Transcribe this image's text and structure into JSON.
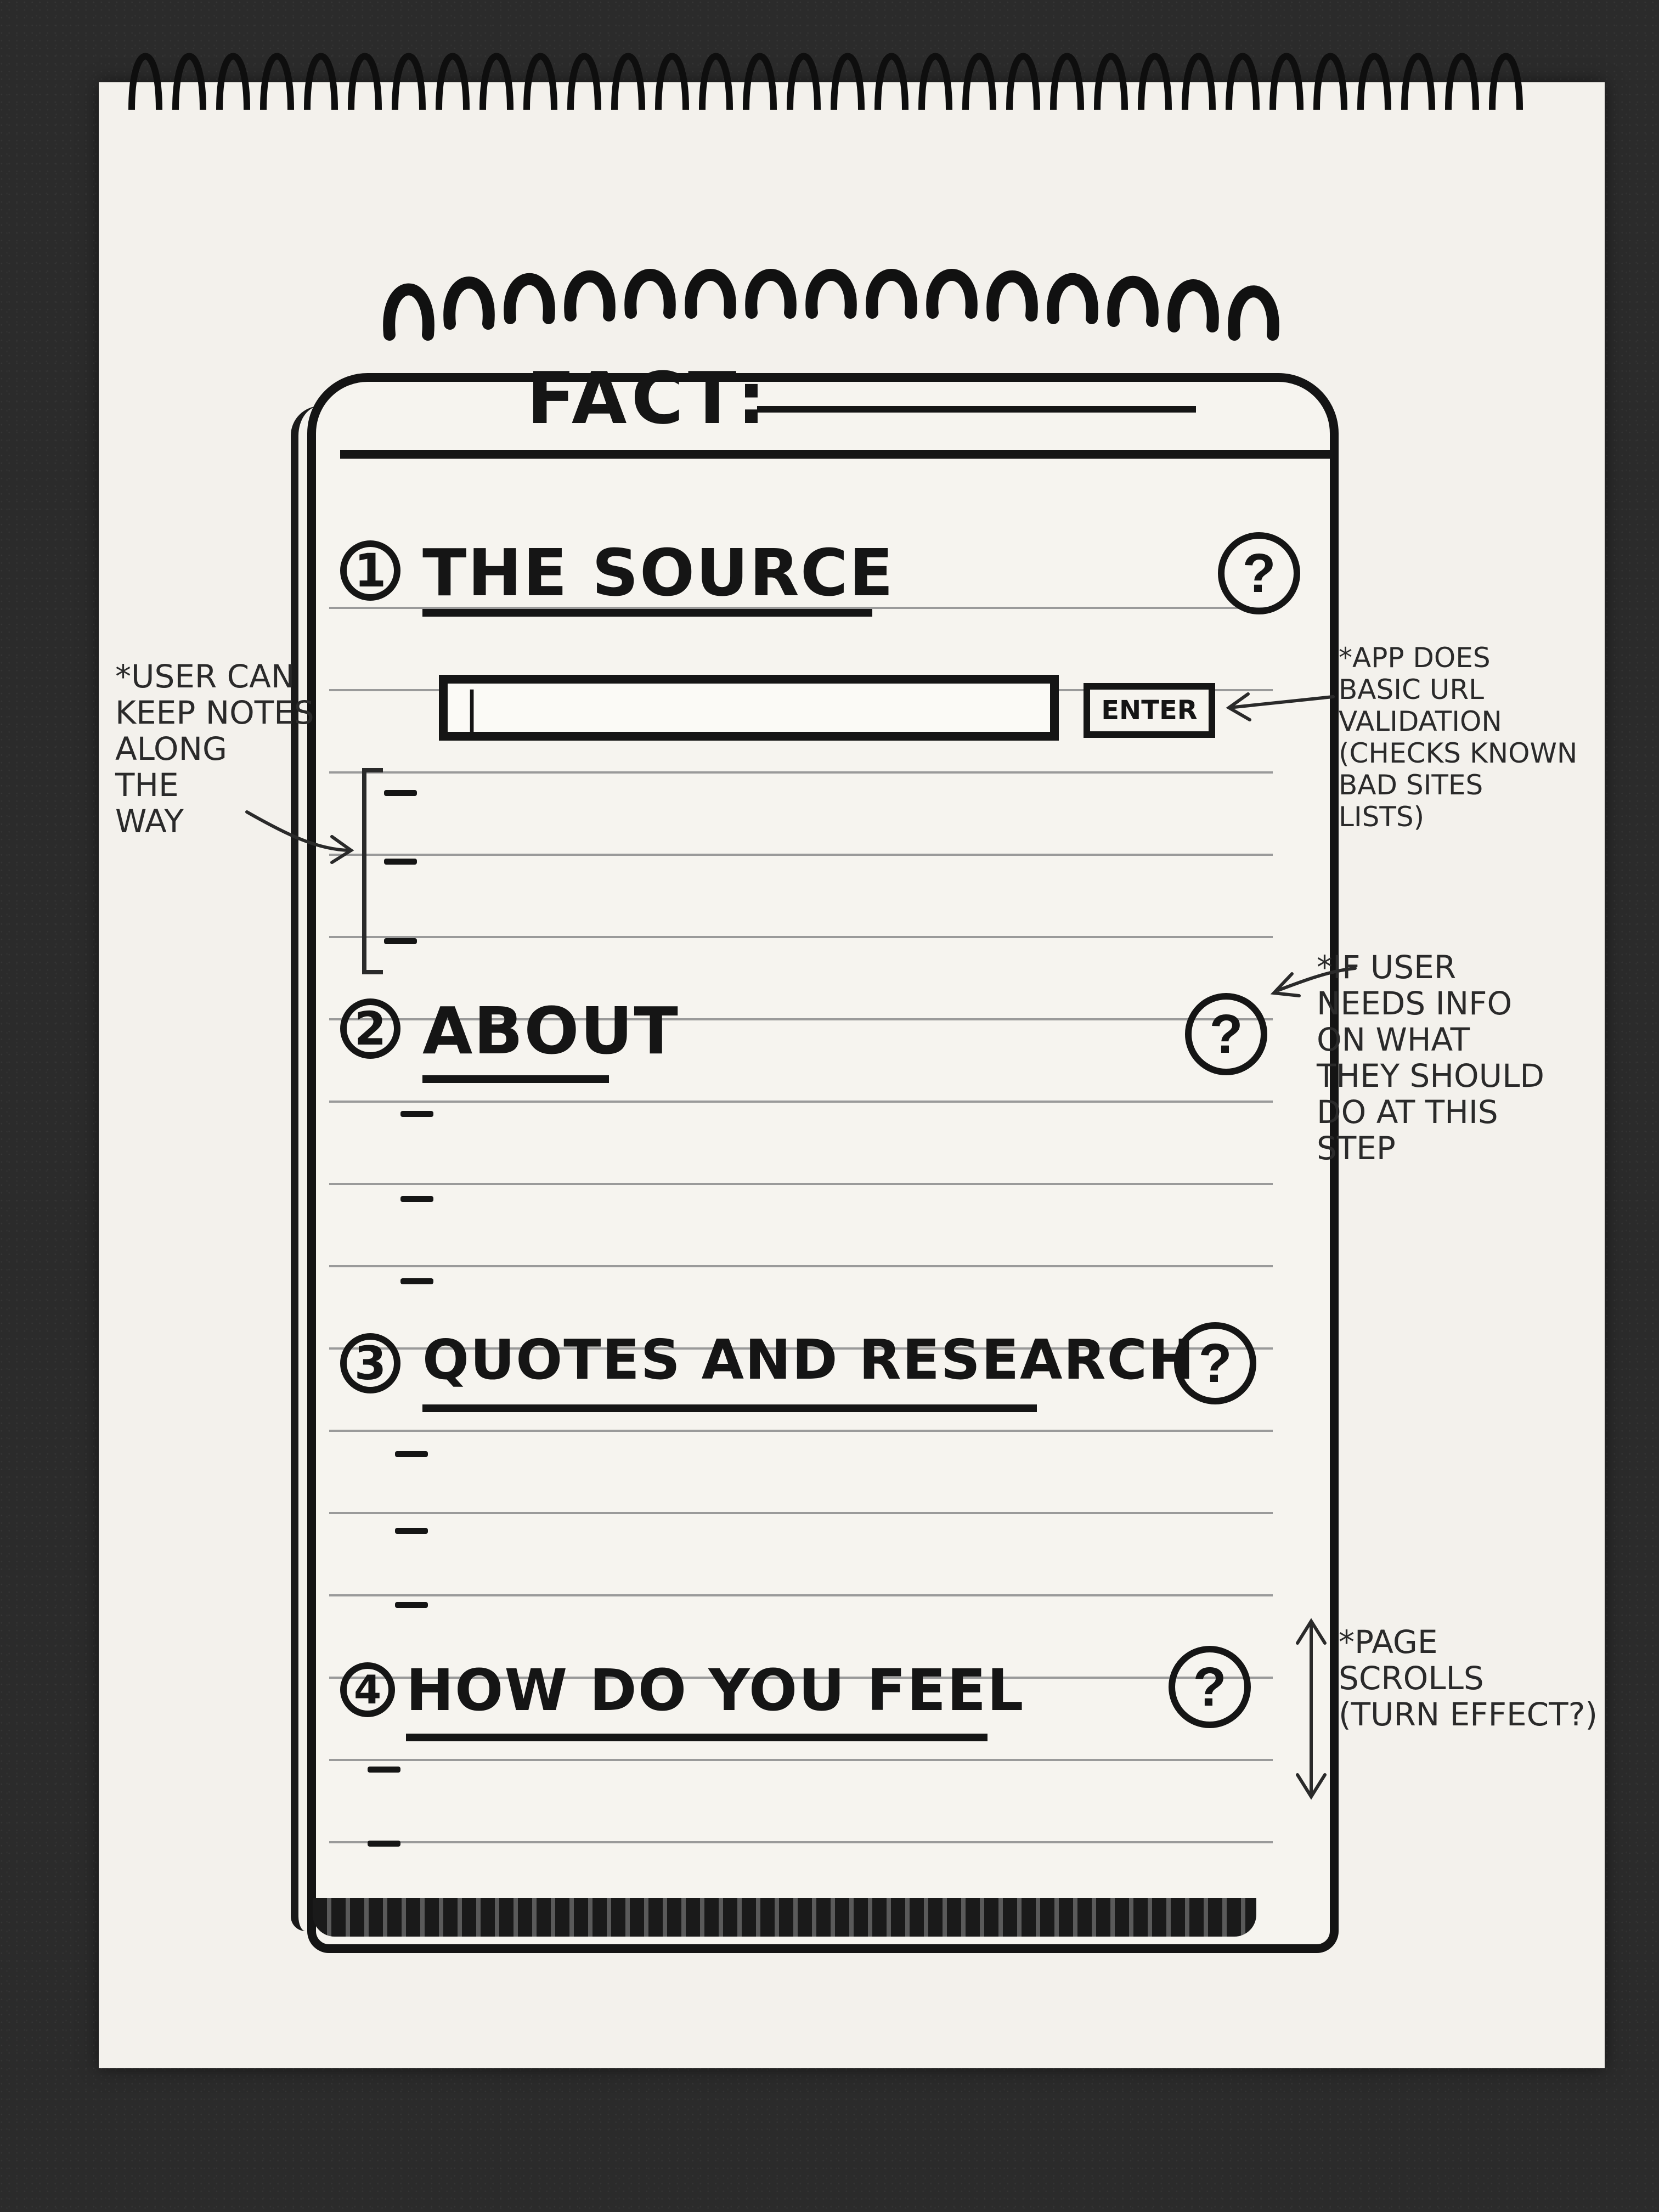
{
  "app": {
    "title_label": "FACT:"
  },
  "source_input": {
    "value": "|",
    "placeholder": ""
  },
  "enter_button": {
    "label": "ENTER"
  },
  "sections": [
    {
      "number": "1",
      "title": "THE SOURCE",
      "help": "?"
    },
    {
      "number": "2",
      "title": "ABOUT",
      "help": "?"
    },
    {
      "number": "3",
      "title": "QUOTES AND RESEARCH",
      "help": "?"
    },
    {
      "number": "4",
      "title": "HOW DO YOU FEEL",
      "help": "?"
    }
  ],
  "annotations": {
    "notes": "*USER CAN\nKEEP NOTES\nALONG\nTHE\nWAY",
    "url_validation": "*APP DOES\nBASIC URL\nVALIDATION\n(CHECKS KNOWN\nBAD SITES\nLISTS)",
    "help_info": "*IF USER\nNEEDS INFO\nON WHAT\nTHEY SHOULD\nDO AT THIS\nSTEP",
    "scroll": "*PAGE\nSCROLLS\n(TURN EFFECT?)"
  }
}
